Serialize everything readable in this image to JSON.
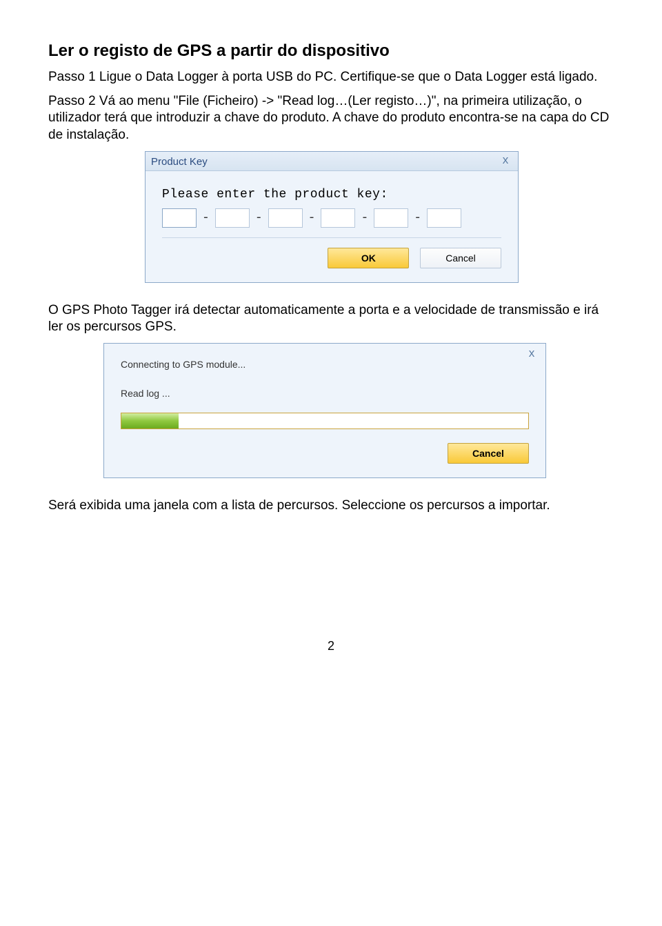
{
  "title": "Ler o registo de GPS a partir do dispositivo",
  "para1a": "Passo 1 Ligue o Data Logger à porta USB do PC. Certifique-se que o Data Logger está ligado.",
  "para1b": "Passo 2 Vá ao menu \"File (Ficheiro) -> \"Read log…(Ler registo…)\", na primeira utilização, o utilizador terá que introduzir a chave do produto. A chave do produto encontra-se na capa do CD de instalação.",
  "dialog1": {
    "title": "Product Key",
    "prompt": "Please enter the product key:",
    "ok": "OK",
    "cancel": "Cancel",
    "close": "x"
  },
  "para2": "O GPS Photo Tagger irá detectar automaticamente a porta e a velocidade de transmissão e irá ler os percursos GPS.",
  "dialog2": {
    "status1": "Connecting to GPS module...",
    "status2": "Read log ...",
    "cancel": "Cancel",
    "close": "x"
  },
  "para3": "Será exibida uma janela com a lista de percursos. Seleccione os percursos a importar.",
  "pagenum": "2"
}
